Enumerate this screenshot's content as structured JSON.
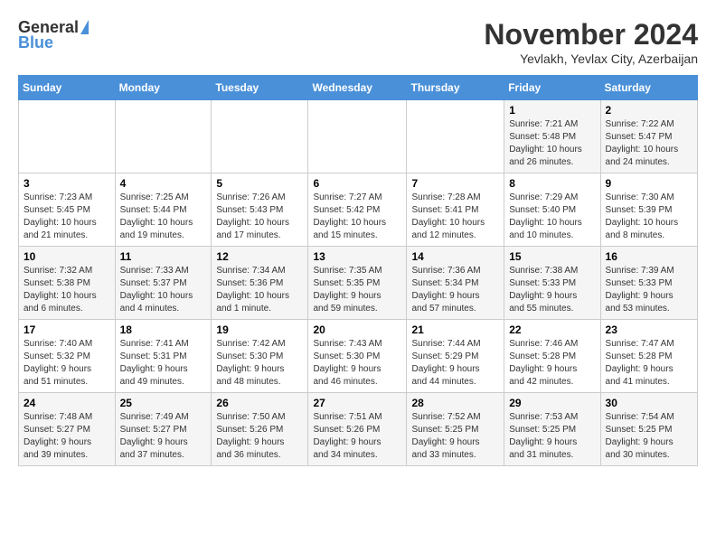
{
  "header": {
    "logo_general": "General",
    "logo_blue": "Blue",
    "month_year": "November 2024",
    "location": "Yevlakh, Yevlax City, Azerbaijan"
  },
  "weekdays": [
    "Sunday",
    "Monday",
    "Tuesday",
    "Wednesday",
    "Thursday",
    "Friday",
    "Saturday"
  ],
  "weeks": [
    [
      {
        "day": "",
        "info": ""
      },
      {
        "day": "",
        "info": ""
      },
      {
        "day": "",
        "info": ""
      },
      {
        "day": "",
        "info": ""
      },
      {
        "day": "",
        "info": ""
      },
      {
        "day": "1",
        "info": "Sunrise: 7:21 AM\nSunset: 5:48 PM\nDaylight: 10 hours\nand 26 minutes."
      },
      {
        "day": "2",
        "info": "Sunrise: 7:22 AM\nSunset: 5:47 PM\nDaylight: 10 hours\nand 24 minutes."
      }
    ],
    [
      {
        "day": "3",
        "info": "Sunrise: 7:23 AM\nSunset: 5:45 PM\nDaylight: 10 hours\nand 21 minutes."
      },
      {
        "day": "4",
        "info": "Sunrise: 7:25 AM\nSunset: 5:44 PM\nDaylight: 10 hours\nand 19 minutes."
      },
      {
        "day": "5",
        "info": "Sunrise: 7:26 AM\nSunset: 5:43 PM\nDaylight: 10 hours\nand 17 minutes."
      },
      {
        "day": "6",
        "info": "Sunrise: 7:27 AM\nSunset: 5:42 PM\nDaylight: 10 hours\nand 15 minutes."
      },
      {
        "day": "7",
        "info": "Sunrise: 7:28 AM\nSunset: 5:41 PM\nDaylight: 10 hours\nand 12 minutes."
      },
      {
        "day": "8",
        "info": "Sunrise: 7:29 AM\nSunset: 5:40 PM\nDaylight: 10 hours\nand 10 minutes."
      },
      {
        "day": "9",
        "info": "Sunrise: 7:30 AM\nSunset: 5:39 PM\nDaylight: 10 hours\nand 8 minutes."
      }
    ],
    [
      {
        "day": "10",
        "info": "Sunrise: 7:32 AM\nSunset: 5:38 PM\nDaylight: 10 hours\nand 6 minutes."
      },
      {
        "day": "11",
        "info": "Sunrise: 7:33 AM\nSunset: 5:37 PM\nDaylight: 10 hours\nand 4 minutes."
      },
      {
        "day": "12",
        "info": "Sunrise: 7:34 AM\nSunset: 5:36 PM\nDaylight: 10 hours\nand 1 minute."
      },
      {
        "day": "13",
        "info": "Sunrise: 7:35 AM\nSunset: 5:35 PM\nDaylight: 9 hours\nand 59 minutes."
      },
      {
        "day": "14",
        "info": "Sunrise: 7:36 AM\nSunset: 5:34 PM\nDaylight: 9 hours\nand 57 minutes."
      },
      {
        "day": "15",
        "info": "Sunrise: 7:38 AM\nSunset: 5:33 PM\nDaylight: 9 hours\nand 55 minutes."
      },
      {
        "day": "16",
        "info": "Sunrise: 7:39 AM\nSunset: 5:33 PM\nDaylight: 9 hours\nand 53 minutes."
      }
    ],
    [
      {
        "day": "17",
        "info": "Sunrise: 7:40 AM\nSunset: 5:32 PM\nDaylight: 9 hours\nand 51 minutes."
      },
      {
        "day": "18",
        "info": "Sunrise: 7:41 AM\nSunset: 5:31 PM\nDaylight: 9 hours\nand 49 minutes."
      },
      {
        "day": "19",
        "info": "Sunrise: 7:42 AM\nSunset: 5:30 PM\nDaylight: 9 hours\nand 48 minutes."
      },
      {
        "day": "20",
        "info": "Sunrise: 7:43 AM\nSunset: 5:30 PM\nDaylight: 9 hours\nand 46 minutes."
      },
      {
        "day": "21",
        "info": "Sunrise: 7:44 AM\nSunset: 5:29 PM\nDaylight: 9 hours\nand 44 minutes."
      },
      {
        "day": "22",
        "info": "Sunrise: 7:46 AM\nSunset: 5:28 PM\nDaylight: 9 hours\nand 42 minutes."
      },
      {
        "day": "23",
        "info": "Sunrise: 7:47 AM\nSunset: 5:28 PM\nDaylight: 9 hours\nand 41 minutes."
      }
    ],
    [
      {
        "day": "24",
        "info": "Sunrise: 7:48 AM\nSunset: 5:27 PM\nDaylight: 9 hours\nand 39 minutes."
      },
      {
        "day": "25",
        "info": "Sunrise: 7:49 AM\nSunset: 5:27 PM\nDaylight: 9 hours\nand 37 minutes."
      },
      {
        "day": "26",
        "info": "Sunrise: 7:50 AM\nSunset: 5:26 PM\nDaylight: 9 hours\nand 36 minutes."
      },
      {
        "day": "27",
        "info": "Sunrise: 7:51 AM\nSunset: 5:26 PM\nDaylight: 9 hours\nand 34 minutes."
      },
      {
        "day": "28",
        "info": "Sunrise: 7:52 AM\nSunset: 5:25 PM\nDaylight: 9 hours\nand 33 minutes."
      },
      {
        "day": "29",
        "info": "Sunrise: 7:53 AM\nSunset: 5:25 PM\nDaylight: 9 hours\nand 31 minutes."
      },
      {
        "day": "30",
        "info": "Sunrise: 7:54 AM\nSunset: 5:25 PM\nDaylight: 9 hours\nand 30 minutes."
      }
    ]
  ]
}
